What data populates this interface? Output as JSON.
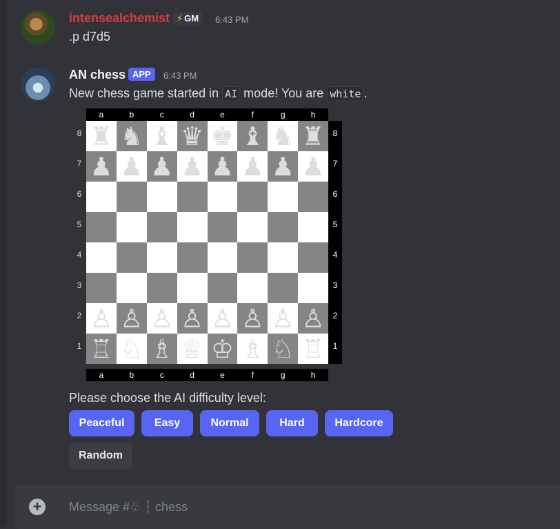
{
  "messages": [
    {
      "author": "intensealchemist",
      "author_color": "#d83c3e",
      "badge": "GM",
      "time": "6:43 PM",
      "text": ".p d7d5"
    },
    {
      "author": "AN chess",
      "author_color": "#f2f3f5",
      "badge": "APP",
      "time": "6:43 PM",
      "text_parts": [
        "New chess game started in ",
        "AI",
        " mode! You are ",
        "white",
        "."
      ]
    }
  ],
  "board": {
    "files": [
      "a",
      "b",
      "c",
      "d",
      "e",
      "f",
      "g",
      "h"
    ],
    "ranks": [
      "8",
      "7",
      "6",
      "5",
      "4",
      "3",
      "2",
      "1"
    ],
    "rows": [
      [
        "♜",
        "♞",
        "♝",
        "♛",
        "♚",
        "♝",
        "♞",
        "♜"
      ],
      [
        "♟",
        "♟",
        "♟",
        "♟",
        "♟",
        "♟",
        "♟",
        "♟"
      ],
      [
        "",
        "",
        "",
        "",
        "",
        "",
        "",
        ""
      ],
      [
        "",
        "",
        "",
        "",
        "",
        "",
        "",
        ""
      ],
      [
        "",
        "",
        "",
        "",
        "",
        "",
        "",
        ""
      ],
      [
        "",
        "",
        "",
        "",
        "",
        "",
        "",
        ""
      ],
      [
        "♙",
        "♙",
        "♙",
        "♙",
        "♙",
        "♙",
        "♙",
        "♙"
      ],
      [
        "♖",
        "♘",
        "♗",
        "♕",
        "♔",
        "♗",
        "♘",
        "♖"
      ]
    ]
  },
  "difficulty": {
    "prompt": "Please choose the AI difficulty level:",
    "buttons": [
      "Peaceful",
      "Easy",
      "Normal",
      "Hard",
      "Hardcore",
      "Random"
    ]
  },
  "composer": {
    "placeholder": "Message #♧ ┆ chess"
  },
  "colors": {
    "accent": "#5865f2",
    "background": "#323339"
  }
}
